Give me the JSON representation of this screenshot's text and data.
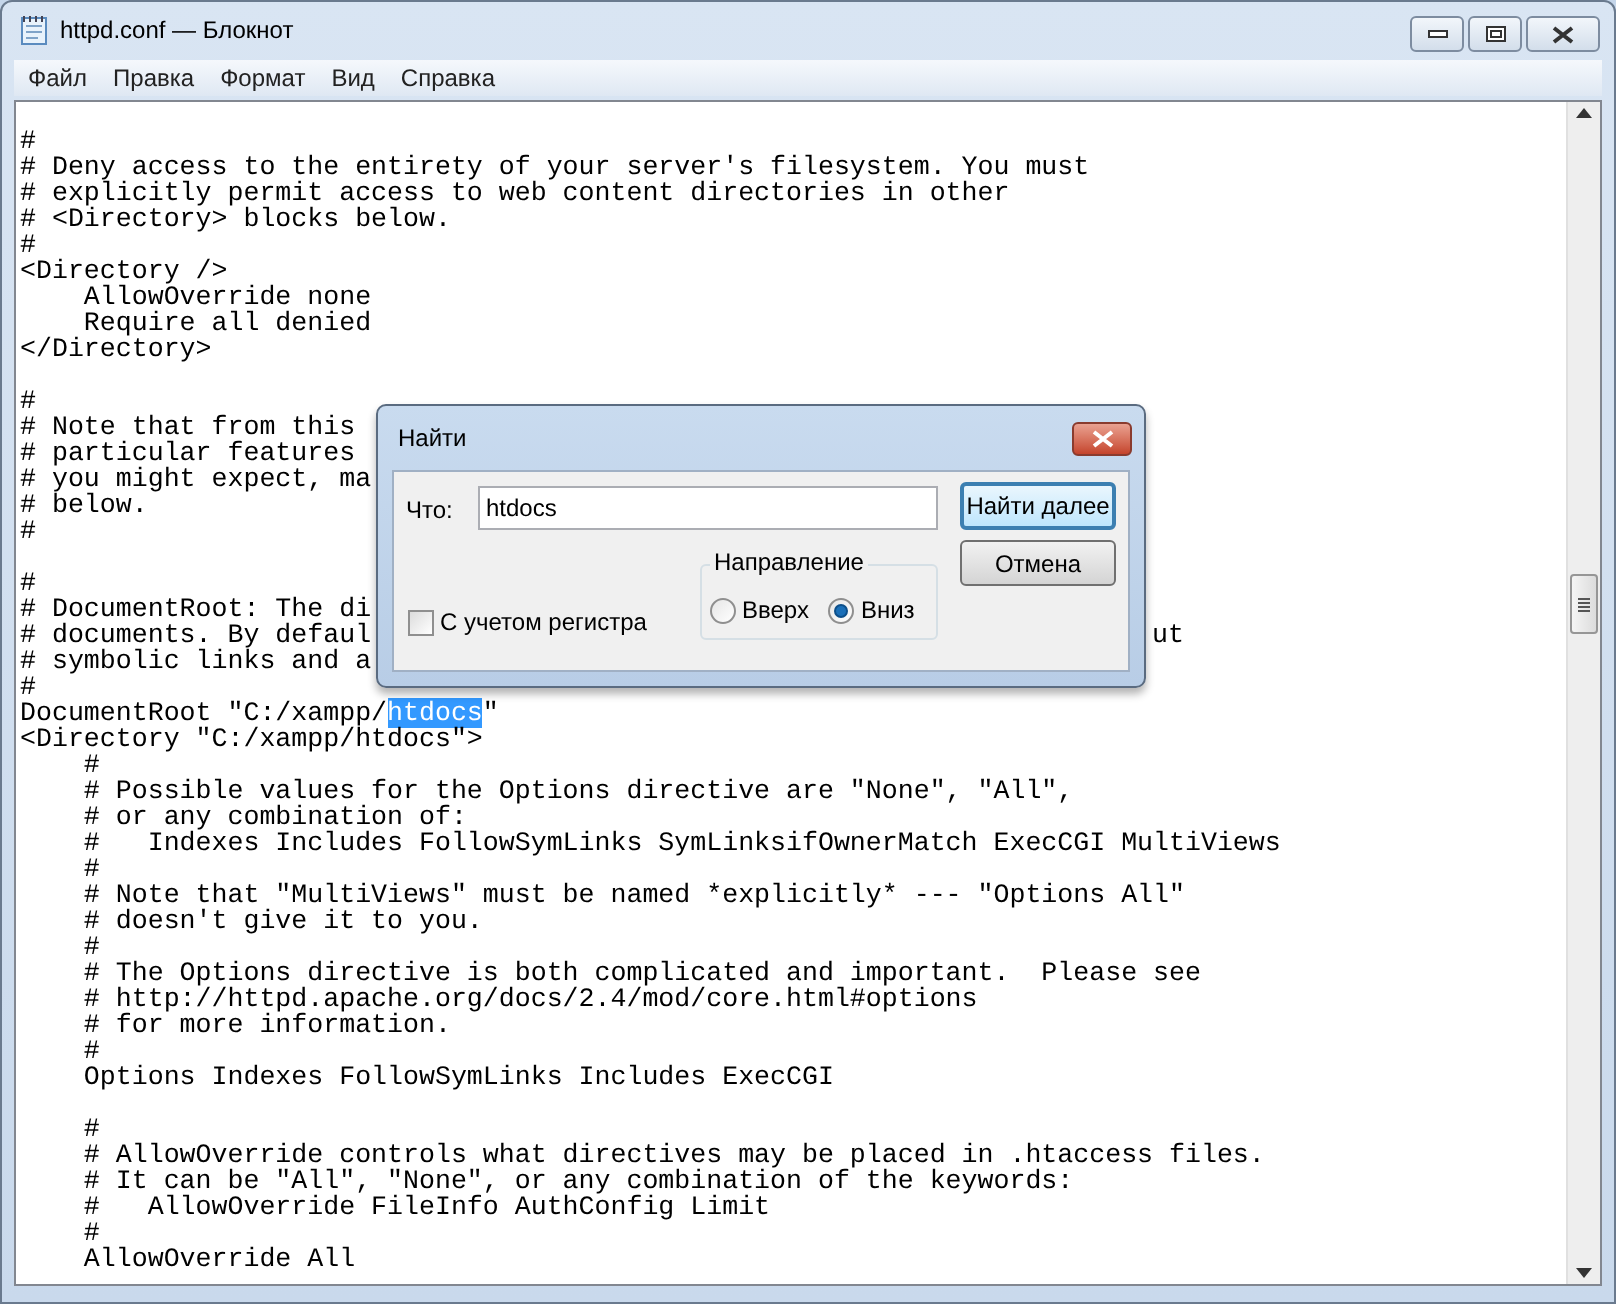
{
  "window": {
    "title": "httpd.conf — Блокнот"
  },
  "menu": [
    "Файл",
    "Правка",
    "Формат",
    "Вид",
    "Справка"
  ],
  "editor": {
    "lines": [
      {
        "kind": "code",
        "text": "#"
      },
      {
        "kind": "code",
        "text": "# Deny access to the entirety of your server's filesystem. You must"
      },
      {
        "kind": "code",
        "text": "# explicitly permit access to web content directories in other"
      },
      {
        "kind": "code",
        "text": "# <Directory> blocks below."
      },
      {
        "kind": "code",
        "text": "#"
      },
      {
        "kind": "code",
        "text": "<Directory />"
      },
      {
        "kind": "code",
        "text": "    AllowOverride none"
      },
      {
        "kind": "code",
        "text": "    Require all denied"
      },
      {
        "kind": "code",
        "text": "</Directory>"
      },
      {
        "kind": "blank"
      },
      {
        "kind": "code",
        "text": "#"
      },
      {
        "kind": "code",
        "text": "# Note that from this"
      },
      {
        "kind": "code",
        "text": "# particular features"
      },
      {
        "kind": "code",
        "text": "# you might expect, ma"
      },
      {
        "kind": "code",
        "text": "# below."
      },
      {
        "kind": "code",
        "text": "#"
      },
      {
        "kind": "blank"
      },
      {
        "kind": "code",
        "text": "#"
      },
      {
        "kind": "code",
        "text": "# DocumentRoot: The di"
      },
      {
        "kind": "code",
        "text": "# documents. By defaul",
        "tail": "ut"
      },
      {
        "kind": "code",
        "text": "# symbolic links and a"
      },
      {
        "kind": "code",
        "text": "#"
      },
      {
        "kind": "match",
        "before": "DocumentRoot \"C:/xampp/",
        "match": "htdocs",
        "after": "\""
      },
      {
        "kind": "code",
        "text": "<Directory \"C:/xampp/htdocs\">"
      },
      {
        "kind": "code",
        "text": "    #"
      },
      {
        "kind": "code",
        "text": "    # Possible values for the Options directive are \"None\", \"All\","
      },
      {
        "kind": "code",
        "text": "    # or any combination of:"
      },
      {
        "kind": "code",
        "text": "    #   Indexes Includes FollowSymLinks SymLinksifOwnerMatch ExecCGI MultiViews"
      },
      {
        "kind": "code",
        "text": "    #"
      },
      {
        "kind": "code",
        "text": "    # Note that \"MultiViews\" must be named *explicitly* --- \"Options All\""
      },
      {
        "kind": "code",
        "text": "    # doesn't give it to you."
      },
      {
        "kind": "code",
        "text": "    #"
      },
      {
        "kind": "code",
        "text": "    # The Options directive is both complicated and important.  Please see"
      },
      {
        "kind": "code",
        "text": "    # http://httpd.apache.org/docs/2.4/mod/core.html#options"
      },
      {
        "kind": "code",
        "text": "    # for more information."
      },
      {
        "kind": "code",
        "text": "    #"
      },
      {
        "kind": "code",
        "text": "    Options Indexes FollowSymLinks Includes ExecCGI"
      },
      {
        "kind": "blank"
      },
      {
        "kind": "code",
        "text": "    #"
      },
      {
        "kind": "code",
        "text": "    # AllowOverride controls what directives may be placed in .htaccess files."
      },
      {
        "kind": "code",
        "text": "    # It can be \"All\", \"None\", or any combination of the keywords:"
      },
      {
        "kind": "code",
        "text": "    #   AllowOverride FileInfo AuthConfig Limit"
      },
      {
        "kind": "code",
        "text": "    #"
      },
      {
        "kind": "code",
        "text": "    AllowOverride All"
      }
    ]
  },
  "find_dialog": {
    "title": "Найти",
    "find_label": "Что:",
    "find_value": "htdocs",
    "find_next_button": "Найти далее",
    "cancel_button": "Отмена",
    "direction": {
      "label": "Направление",
      "options": [
        {
          "label": "Вверх",
          "selected": false
        },
        {
          "label": "Вниз",
          "selected": true
        }
      ]
    },
    "match_case": {
      "label": "С учетом регистра",
      "checked": false
    }
  }
}
